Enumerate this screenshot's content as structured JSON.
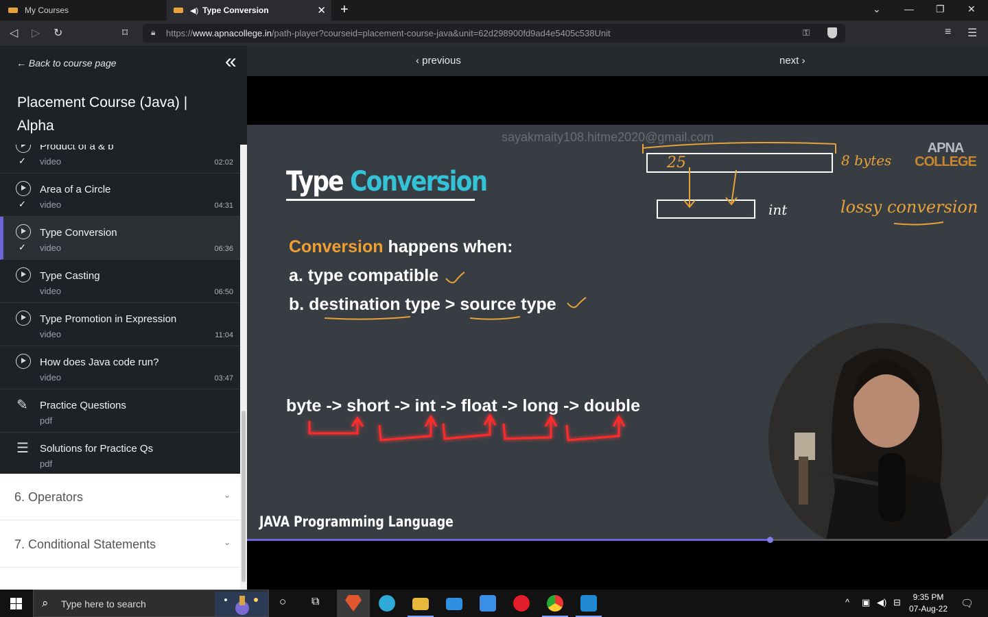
{
  "browser": {
    "tabs": [
      {
        "label": "My Courses"
      },
      {
        "label": "Type Conversion"
      }
    ],
    "url_prefix": "https://",
    "url_host": "www.apnacollege.in",
    "url_path": "/path-player?courseid=placement-course-java&unit=62d298900fd9ad4e5405c538Unit"
  },
  "sidebar": {
    "back_label": "Back to course page",
    "course_title": "Placement Course (Java) | Alpha",
    "lessons": [
      {
        "title": "Product of a & b",
        "type": "video",
        "duration": "02:02",
        "completed": true,
        "kind": "video"
      },
      {
        "title": "Area of a Circle",
        "type": "video",
        "duration": "04:31",
        "completed": true,
        "kind": "video"
      },
      {
        "title": "Type Conversion",
        "type": "video",
        "duration": "06:36",
        "completed": true,
        "kind": "video",
        "active": true
      },
      {
        "title": "Type Casting",
        "type": "video",
        "duration": "06:50",
        "completed": false,
        "kind": "video"
      },
      {
        "title": "Type Promotion in Expression",
        "type": "video",
        "duration": "11:04",
        "completed": false,
        "kind": "video"
      },
      {
        "title": "How does Java code run?",
        "type": "video",
        "duration": "03:47",
        "completed": false,
        "kind": "video"
      },
      {
        "title": "Practice Questions",
        "type": "pdf",
        "duration": "",
        "completed": false,
        "kind": "pdf"
      },
      {
        "title": "Solutions for Practice Qs",
        "type": "pdf",
        "duration": "",
        "completed": false,
        "kind": "checklist"
      }
    ],
    "sections": [
      {
        "label": "6. Operators"
      },
      {
        "label": "7. Conditional Statements"
      }
    ]
  },
  "player": {
    "previous_label": "previous",
    "next_label": "next",
    "progress_fraction": 0.706
  },
  "slide": {
    "watermark": "sayakmaity108.hitme2020@gmail.com",
    "logo_line1": "APNA",
    "logo_line2": "COLLEGE",
    "title_part1": "Type ",
    "title_part2": "Conversion",
    "condition_highlight": "Conversion",
    "condition_rest": " happens when:",
    "condition_a": "a. type compatible",
    "condition_b": "b. destination type > source type",
    "chain": "byte -> short -> int -> float -> long -> double",
    "footer": "JAVA Programming Language",
    "handwritten": {
      "value": "25",
      "bytes": "8 bytes",
      "int": "int",
      "lossy": "lossy conversion"
    }
  },
  "taskbar": {
    "search_placeholder": "Type here to search",
    "time": "9:35 PM",
    "date": "07-Aug-22"
  },
  "colors": {
    "accent": "#6a64d6",
    "slide_bg": "#383d43",
    "title_accent": "#33c2d6",
    "orange": "#f0a030",
    "ink": "#e7a23a",
    "arrows": "#ff2a2a"
  }
}
